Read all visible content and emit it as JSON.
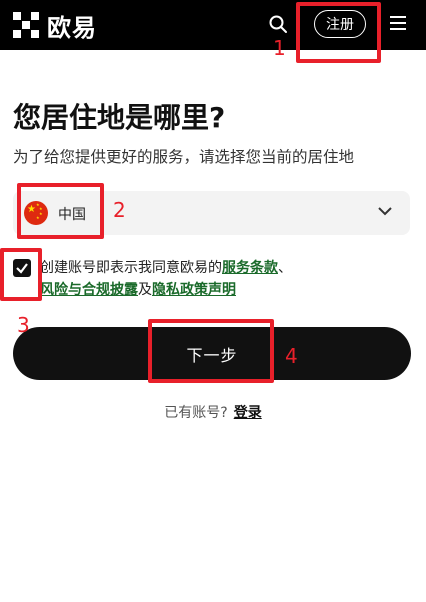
{
  "header": {
    "logo_text": "欧易",
    "register_label": "注册",
    "icons": [
      "okx-logo-icon",
      "search-icon",
      "menu-icon"
    ]
  },
  "main": {
    "title": "您居住地是哪里?",
    "subtitle": "为了给您提供更好的服务，请选择您当前的居住地",
    "country": {
      "flag": "china-flag-icon",
      "selected": "中国"
    },
    "agreement": {
      "checked": true,
      "text_prefix": "创建账号即表示我同意欧易的",
      "link_terms": "服务条款",
      "separator": "、",
      "link_risk": "风险与合规披露",
      "and": "及",
      "link_privacy": "隐私政策声明"
    },
    "next_label": "下一步",
    "login_prompt": "已有账号?",
    "login_link": "登录"
  },
  "annotations": {
    "labels": [
      "1",
      "2",
      "3",
      "4"
    ],
    "color": "#e8202a"
  },
  "colors": {
    "header_bg": "#000000",
    "button_bg": "#111111",
    "link_green": "#1a6a2a",
    "select_bg": "#f3f3f3"
  }
}
